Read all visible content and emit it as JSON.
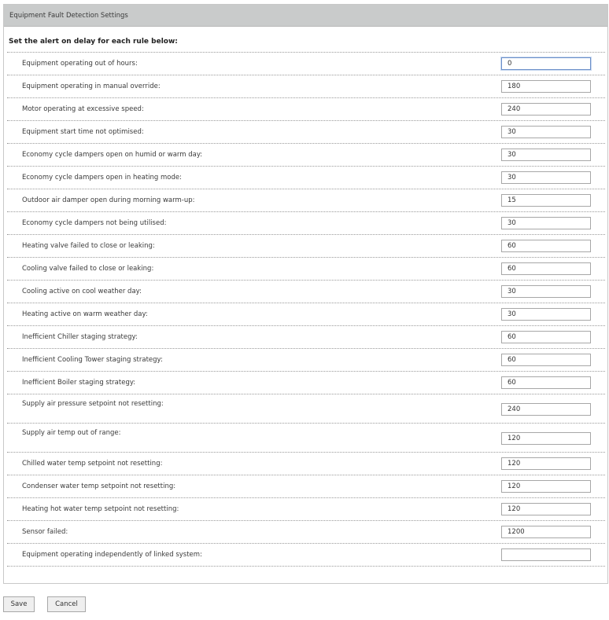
{
  "panel": {
    "title": "Equipment Fault Detection Settings",
    "intro": "Set the alert on delay for each rule below:"
  },
  "rules": [
    {
      "label": "Equipment operating out of hours:",
      "value": "0",
      "focused": true
    },
    {
      "label": "Equipment operating in manual override:",
      "value": "180"
    },
    {
      "label": "Motor operating at excessive speed:",
      "value": "240"
    },
    {
      "label": "Equipment start time not optimised:",
      "value": "30"
    },
    {
      "label": "Economy cycle dampers open on humid or warm day:",
      "value": "30"
    },
    {
      "label": "Economy cycle dampers open in heating mode:",
      "value": "30"
    },
    {
      "label": "Outdoor air damper open during morning warm-up:",
      "value": "15"
    },
    {
      "label": "Economy cycle dampers not being utilised:",
      "value": "30"
    },
    {
      "label": "Heating valve failed to close or leaking:",
      "value": "60"
    },
    {
      "label": "Cooling valve failed to close or leaking:",
      "value": "60"
    },
    {
      "label": "Cooling active on cool weather day:",
      "value": "30"
    },
    {
      "label": "Heating active on warm weather day:",
      "value": "30"
    },
    {
      "label": "Inefficient Chiller staging strategy:",
      "value": "60"
    },
    {
      "label": "Inefficient Cooling Tower staging strategy:",
      "value": "60"
    },
    {
      "label": "Inefficient Boiler staging strategy:",
      "value": "60"
    },
    {
      "label": "Supply air pressure setpoint not resetting:",
      "value": "240",
      "tall": true
    },
    {
      "label": "Supply air temp out of range:",
      "value": "120",
      "tall": true
    },
    {
      "label": "Chilled water temp setpoint not resetting:",
      "value": "120"
    },
    {
      "label": "Condenser water temp setpoint not resetting:",
      "value": "120"
    },
    {
      "label": "Heating hot water temp setpoint not resetting:",
      "value": "120"
    },
    {
      "label": "Sensor failed:",
      "value": "1200"
    },
    {
      "label": "Equipment operating independently of linked system:",
      "value": ""
    }
  ],
  "actions": {
    "save_label": "Save",
    "cancel_label": "Cancel"
  }
}
